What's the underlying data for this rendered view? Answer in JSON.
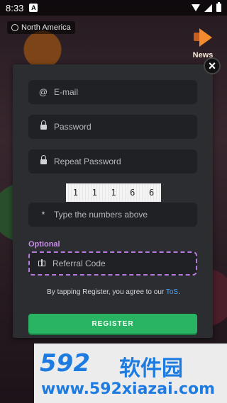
{
  "status_bar": {
    "time": "8:33",
    "app_icon": "A"
  },
  "region": {
    "label": "North America",
    "icon": "globe-icon"
  },
  "news": {
    "label": "News",
    "icon": "megaphone-icon"
  },
  "modal": {
    "close_icon": "×",
    "fields": {
      "email": {
        "placeholder": "E-mail",
        "icon": "@"
      },
      "password": {
        "placeholder": "Password"
      },
      "repeat_password": {
        "placeholder": "Repeat Password"
      },
      "captcha_answer": {
        "placeholder": "Type the numbers above",
        "icon": "*"
      }
    },
    "captcha_digits": [
      "1",
      "1",
      "1",
      "6",
      "6"
    ],
    "optional_label": "Optional",
    "referral": {
      "placeholder": "Referral Code"
    },
    "tos_prefix": "By tapping Register, you agree to our",
    "tos_link": "ToS",
    "tos_suffix": ".",
    "register_label": "REGISTER"
  },
  "watermark": {
    "brand_number": "592",
    "brand_cn": "软件园",
    "url": "www.592xiazai.com"
  },
  "colors": {
    "accent_green": "#28b463",
    "optional_purple": "#c98ce6",
    "link_blue": "#49a3ff"
  }
}
